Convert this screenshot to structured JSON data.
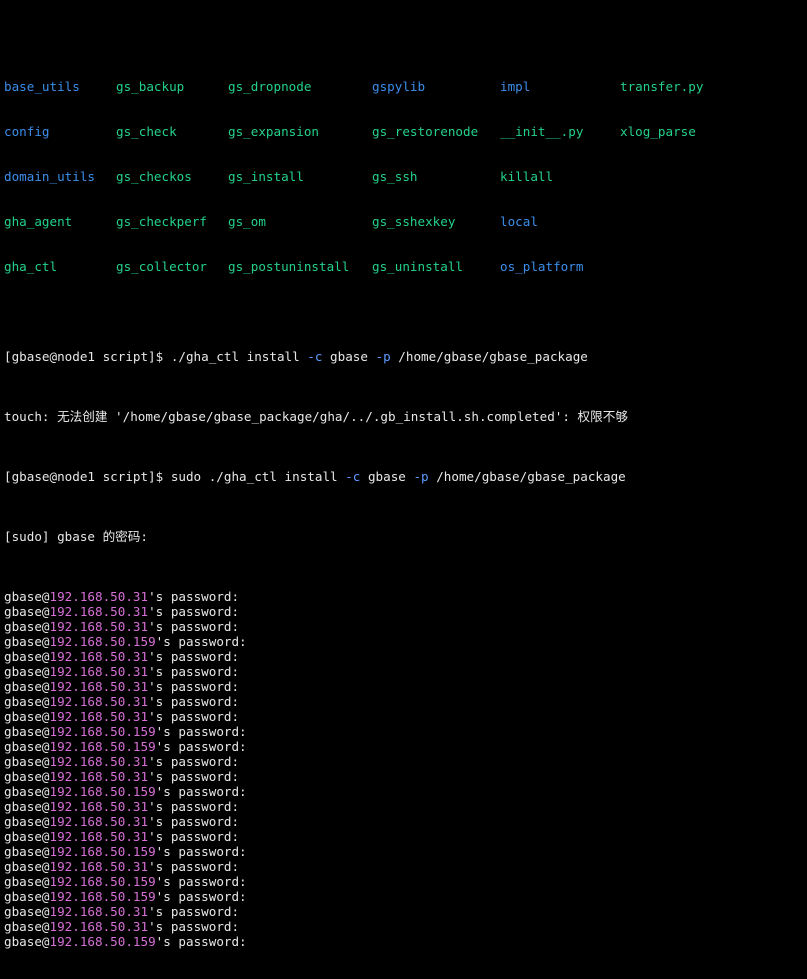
{
  "ls_listing": [
    [
      {
        "name": "base_utils",
        "type": "dir"
      },
      {
        "name": "gs_backup",
        "type": "exe"
      },
      {
        "name": "gs_dropnode",
        "type": "exe"
      },
      {
        "name": "gspylib",
        "type": "dir"
      },
      {
        "name": "impl",
        "type": "dir"
      },
      {
        "name": "transfer.py",
        "type": "exe"
      }
    ],
    [
      {
        "name": "config",
        "type": "dir"
      },
      {
        "name": "gs_check",
        "type": "exe"
      },
      {
        "name": "gs_expansion",
        "type": "exe"
      },
      {
        "name": "gs_restorenode",
        "type": "exe"
      },
      {
        "name": "__init__.py",
        "type": "exe"
      },
      {
        "name": "xlog_parse",
        "type": "exe"
      }
    ],
    [
      {
        "name": "domain_utils",
        "type": "dir"
      },
      {
        "name": "gs_checkos",
        "type": "exe"
      },
      {
        "name": "gs_install",
        "type": "exe"
      },
      {
        "name": "gs_ssh",
        "type": "exe"
      },
      {
        "name": "killall",
        "type": "exe"
      },
      {
        "name": "",
        "type": "exe"
      }
    ],
    [
      {
        "name": "gha_agent",
        "type": "exe"
      },
      {
        "name": "gs_checkperf",
        "type": "exe"
      },
      {
        "name": "gs_om",
        "type": "exe"
      },
      {
        "name": "gs_sshexkey",
        "type": "exe"
      },
      {
        "name": "local",
        "type": "dir"
      },
      {
        "name": "",
        "type": "exe"
      }
    ],
    [
      {
        "name": "gha_ctl",
        "type": "exe"
      },
      {
        "name": "gs_collector",
        "type": "exe"
      },
      {
        "name": "gs_postuninstall",
        "type": "exe"
      },
      {
        "name": "gs_uninstall",
        "type": "exe"
      },
      {
        "name": "os_platform",
        "type": "dir"
      },
      {
        "name": "",
        "type": "exe"
      }
    ]
  ],
  "commands": {
    "prompt": "[gbase@node1 script]$ ",
    "cmd1": {
      "p1": "./gha_ctl install ",
      "f1": "-c",
      "p2": " gbase ",
      "f2": "-p",
      "p3": " /home/gbase/gbase_package"
    },
    "touch_error": "touch: 无法创建 '/home/gbase/gbase_package/gha/../.gb_install.sh.completed': 权限不够",
    "cmd2": {
      "p1": "sudo ./gha_ctl install ",
      "f1": "-c",
      "p2": " gbase ",
      "f2": "-p",
      "p3": " /home/gbase/gbase_package"
    },
    "sudo_prompt": "[sudo] gbase 的密码:"
  },
  "password_prompts": {
    "user_prefix": "gbase@",
    "suffix": "'s password:",
    "hosts": [
      "192.168.50.31",
      "192.168.50.31",
      "192.168.50.31",
      "192.168.50.159",
      "192.168.50.31",
      "192.168.50.31",
      "192.168.50.31",
      "192.168.50.31",
      "192.168.50.31",
      "192.168.50.159",
      "192.168.50.159",
      "192.168.50.31",
      "192.168.50.31",
      "192.168.50.159",
      "192.168.50.31",
      "192.168.50.31",
      "192.168.50.31",
      "192.168.50.159",
      "192.168.50.31",
      "192.168.50.159",
      "192.168.50.159",
      "192.168.50.31",
      "192.168.50.31",
      "192.168.50.159"
    ]
  },
  "colors": {
    "background": "#000000",
    "foreground": "#e8e8e8",
    "directory": "#3b8eea",
    "executable": "#23d18b",
    "host": "#d670d6",
    "flag": "#5e9bff"
  }
}
